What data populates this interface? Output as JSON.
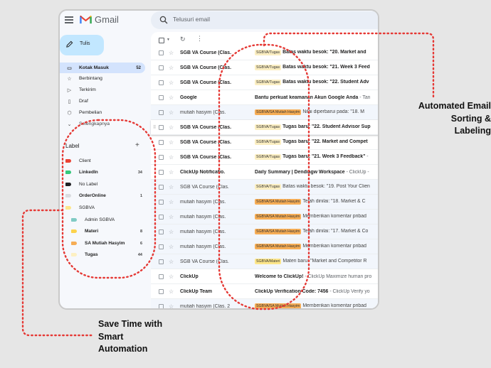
{
  "app": {
    "name": "Gmail"
  },
  "search": {
    "placeholder": "Telusuri email"
  },
  "compose": {
    "label": "Tulis"
  },
  "nav": [
    {
      "label": "Kotak Masuk",
      "count": "52",
      "icon": "inbox-icon"
    },
    {
      "label": "Berbintang",
      "count": "",
      "icon": "star-icon"
    },
    {
      "label": "Terkirim",
      "count": "",
      "icon": "send-icon"
    },
    {
      "label": "Draf",
      "count": "",
      "icon": "draft-icon"
    },
    {
      "label": "Pembelian",
      "count": "",
      "icon": "tag-icon"
    },
    {
      "label": "Selengkapnya",
      "count": "",
      "icon": "chevron-down-icon"
    }
  ],
  "labels": {
    "heading": "Label",
    "items": [
      {
        "name": "Client",
        "count": "",
        "color": "#ea4335",
        "bold": false,
        "indent": false
      },
      {
        "name": "LinkedIn",
        "count": "34",
        "color": "#34c77b",
        "bold": true,
        "indent": false
      },
      {
        "name": "No Label",
        "count": "",
        "color": "#202124",
        "bold": false,
        "indent": false
      },
      {
        "name": "OrderOnline",
        "count": "1",
        "color": "#dadce0",
        "bold": true,
        "indent": false
      },
      {
        "name": "SGBVA",
        "count": "",
        "color": "#fde68a",
        "bold": false,
        "indent": false
      },
      {
        "name": "Admin SGBVA",
        "count": "",
        "color": "#80cbc4",
        "bold": false,
        "indent": true
      },
      {
        "name": "Materi",
        "count": "8",
        "color": "#fcd34d",
        "bold": true,
        "indent": true
      },
      {
        "name": "SA Mutiah Hasyim",
        "count": "6",
        "color": "#f6ad55",
        "bold": true,
        "indent": true
      },
      {
        "name": "Tugas",
        "count": "44",
        "color": "#fdf0c2",
        "bold": true,
        "indent": true
      }
    ]
  },
  "emails": [
    {
      "sender": "SGB VA Course (Clas.",
      "tag": "SGBVA/Tugas",
      "subject": "Batas waktu besok: \"20. Market and",
      "snippet": "",
      "unread": true
    },
    {
      "sender": "SGB VA Course (Clas.",
      "tag": "SGBVA/Tugas",
      "subject": "Batas waktu besok: \"21. Week 3 Feed",
      "snippet": "",
      "unread": true
    },
    {
      "sender": "SGB VA Course (Clas.",
      "tag": "SGBVA/Tugas",
      "subject": "Batas waktu besok: \"22. Student Adv",
      "snippet": "",
      "unread": true
    },
    {
      "sender": "Google",
      "tag": "",
      "subject": "Bantu perkuat keamanan Akun Google Anda",
      "snippet": " - Tan",
      "unread": true
    },
    {
      "sender": "mutiah hasyim (Clas.",
      "tag": "SGBVA/SA Mutiah Hasyim",
      "subject": "Nilai diperbarui pada: \"18. M",
      "snippet": "",
      "unread": false
    },
    {
      "sender": "SGB VA Course (Clas.",
      "tag": "SGBVA/Tugas",
      "subject": "Tugas baru: \"22. Student Advisor Sup",
      "snippet": "",
      "unread": true,
      "hover": true
    },
    {
      "sender": "SGB VA Course (Clas.",
      "tag": "SGBVA/Tugas",
      "subject": "Tugas baru: \"22. Market and Compet",
      "snippet": "",
      "unread": true
    },
    {
      "sender": "SGB VA Course (Clas.",
      "tag": "SGBVA/Tugas",
      "subject": "Tugas baru: \"21. Week 3 Feedback\"",
      "snippet": " - ",
      "unread": true
    },
    {
      "sender": "ClickUp Notificatio.",
      "tag": "",
      "subject": "Daily Summary | Dendiagw Workspace",
      "snippet": " - ClickUp -",
      "unread": true
    },
    {
      "sender": "SGB VA Course (Clas.",
      "tag": "SGBVA/Tugas",
      "subject": "Batas waktu besok: \"19. Post Your Clien",
      "snippet": "",
      "unread": false
    },
    {
      "sender": "mutiah hasyim (Clas.",
      "tag": "SGBVA/SA Mutiah Hasyim",
      "subject": "Telah dinilai: \"18. Market & C",
      "snippet": "",
      "unread": false
    },
    {
      "sender": "mutiah hasyim (Clas.",
      "tag": "SGBVA/SA Mutiah Hasyim",
      "subject": "Memberikan komentar pribad",
      "snippet": "",
      "unread": false
    },
    {
      "sender": "mutiah hasyim (Clas.",
      "tag": "SGBVA/SA Mutiah Hasyim",
      "subject": "Telah dinilai: \"17. Market & Co",
      "snippet": "",
      "unread": false
    },
    {
      "sender": "mutiah hasyim (Clas.",
      "tag": "SGBVA/SA Mutiah Hasyim",
      "subject": "Memberikan komentar pribad",
      "snippet": "",
      "unread": false
    },
    {
      "sender": "SGB VA Course (Clas.",
      "tag": "SGBVA/Materi",
      "subject": "Materi baru: \"Market and Competitor R",
      "snippet": "",
      "unread": false
    },
    {
      "sender": "ClickUp",
      "tag": "",
      "subject": "Welcome to ClickUp!",
      "snippet": " - ClickUp Maximize human pro",
      "unread": true
    },
    {
      "sender": "ClickUp Team",
      "tag": "",
      "subject": "ClickUp Verification Code: 7456",
      "snippet": " - ClickUp Verify yo",
      "unread": true
    },
    {
      "sender": "mutiah hasyim (Clas. 2",
      "tag": "SGBVA/SA Mutiah Hasyim",
      "subject": "Memberikan komentar pribad",
      "snippet": "",
      "unread": false
    }
  ],
  "tag_colors": {
    "SGBVA/Tugas": "#fbeec1",
    "SGBVA/SA Mutiah Hasyim": "#f6ad55",
    "SGBVA/Materi": "#fde68a"
  },
  "callouts": {
    "right": [
      "Automated Email",
      "Sorting &",
      "Labeling"
    ],
    "left": [
      "Save Time with",
      "Smart",
      "Automation"
    ]
  },
  "annotation_color": "#e53935"
}
